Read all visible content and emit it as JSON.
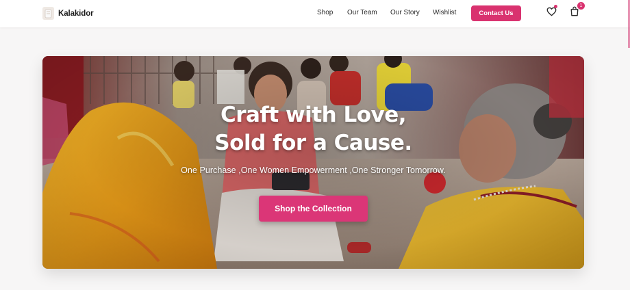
{
  "brand": {
    "name": "Kalakidor"
  },
  "nav": {
    "links": [
      "Shop",
      "Our Team",
      "Our Story",
      "Wishlist"
    ],
    "contact_label": "Contact Us",
    "cart_count": "1"
  },
  "hero": {
    "title_line1": "Craft with Love,",
    "title_line2": "Sold for a Cause.",
    "subtitle": "One Purchase ,One Women Empowerment ,One Stronger Tomorrow.",
    "cta_label": "Shop the Collection"
  },
  "colors": {
    "accent": "#d9326f",
    "page_bg": "#f7f6f6",
    "nav_bg": "#ffffff"
  },
  "icons": {
    "wishlist": "heart-icon",
    "cart": "shopping-bag-icon",
    "logo": "logo-mark-icon"
  }
}
